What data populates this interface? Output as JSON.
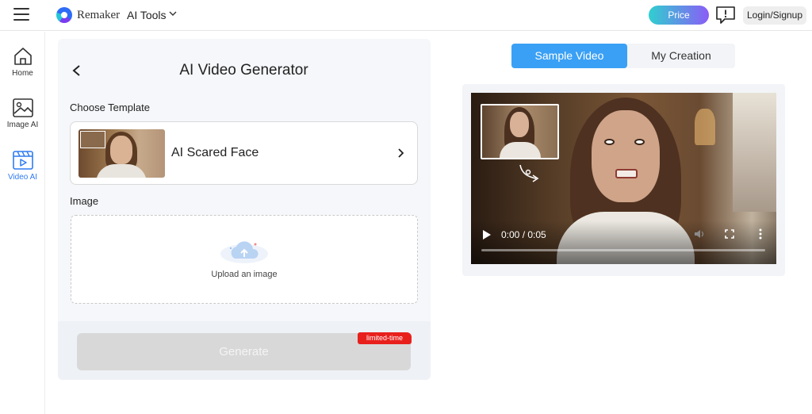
{
  "header": {
    "brand": "Remaker",
    "ai_tools": "AI Tools",
    "price": "Price",
    "login": "Login/Signup"
  },
  "sidebar": {
    "items": [
      {
        "label": "Home",
        "icon": "home-icon"
      },
      {
        "label": "Image AI",
        "icon": "image-icon"
      },
      {
        "label": "Video AI",
        "icon": "video-icon",
        "active": true
      }
    ]
  },
  "panel": {
    "title": "AI Video Generator",
    "choose_template": "Choose Template",
    "template_name": "AI Scared Face",
    "image_label": "Image",
    "upload_text": "Upload an image",
    "generate": "Generate",
    "badge": "limited-time"
  },
  "tabs": [
    {
      "label": "Sample Video",
      "active": true
    },
    {
      "label": "My Creation",
      "active": false
    }
  ],
  "player": {
    "time": "0:00 / 0:05",
    "progress": 0
  },
  "colors": {
    "accent": "#3aa0f5",
    "sidebar_active": "#2f7bf2",
    "badge": "#e8201c",
    "price_gradient_start": "#2fcfd0",
    "price_gradient_end": "#8b5cf6"
  }
}
